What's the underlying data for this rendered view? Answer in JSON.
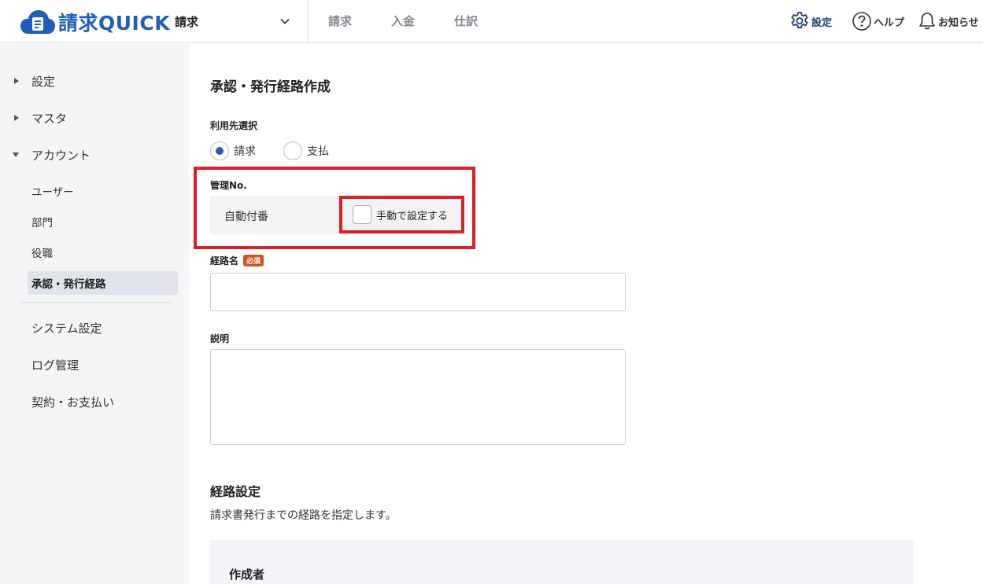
{
  "header": {
    "logo_text": "請求QUICK",
    "module_select": "請求",
    "nav_tabs": [
      "請求",
      "入金",
      "仕訳"
    ],
    "settings_label": "設定",
    "help_label": "ヘルプ",
    "notifications_label": "お知らせ",
    "brand_color": "#1f5fb8"
  },
  "sidebar": {
    "groups": [
      {
        "label": "設定",
        "expanded": false
      },
      {
        "label": "マスタ",
        "expanded": false
      },
      {
        "label": "アカウント",
        "expanded": true
      }
    ],
    "account_items": [
      "ユーザー",
      "部門",
      "役職",
      "承認・発行経路"
    ],
    "active_item": "承認・発行経路",
    "bottom_items": [
      "システム設定",
      "ログ管理",
      "契約・お支払い"
    ]
  },
  "form": {
    "page_title": "承認・発行経路作成",
    "usage_label": "利用先選択",
    "usage_options": [
      "請求",
      "支払"
    ],
    "usage_selected": "請求",
    "management_no_label": "管理No.",
    "auto_number_text": "自動付番",
    "manual_checkbox_label": "手動で設定する",
    "manual_checked": false,
    "route_name_label": "経路名",
    "required_badge": "必須",
    "route_name_value": "",
    "description_label": "説明",
    "description_value": "",
    "highlight_color": "#e01c24"
  },
  "route_settings": {
    "title": "経路設定",
    "description": "請求書発行までの経路を指定します。",
    "panel_title": "作成者"
  }
}
